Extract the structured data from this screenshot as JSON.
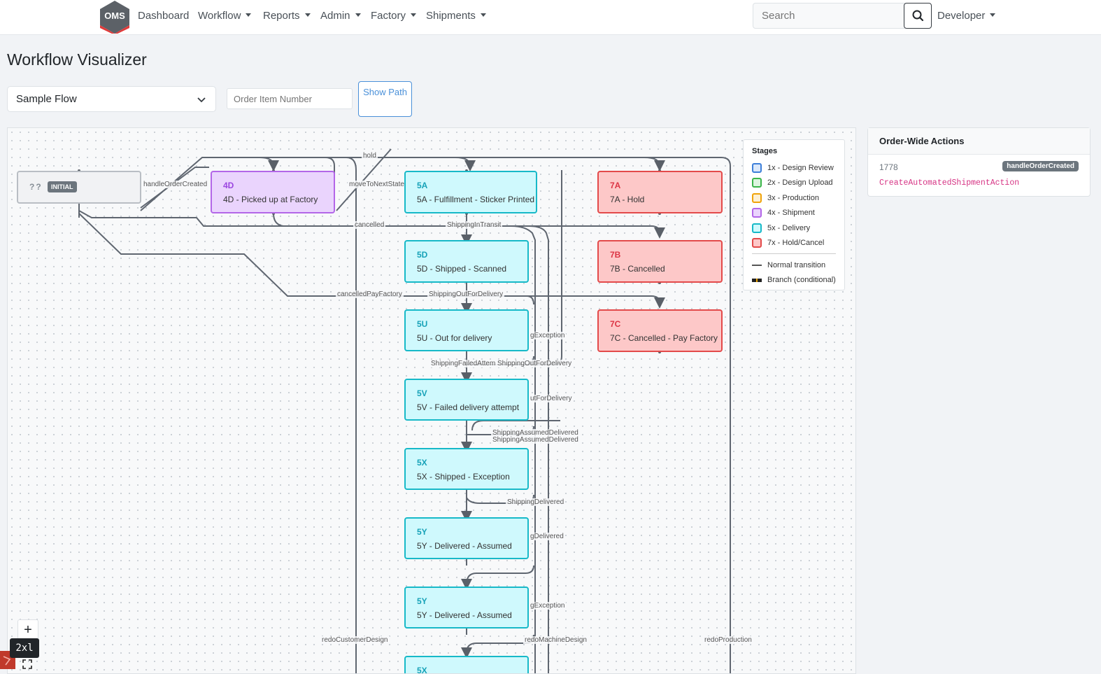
{
  "navbar": {
    "logo_text": "OMS",
    "items": [
      {
        "label": "Dashboard",
        "dropdown": false
      },
      {
        "label": "Workflow",
        "dropdown": true
      },
      {
        "label": "Reports",
        "dropdown": true
      },
      {
        "label": "Admin",
        "dropdown": true
      },
      {
        "label": "Factory",
        "dropdown": true
      },
      {
        "label": "Shipments",
        "dropdown": true
      }
    ],
    "search_placeholder": "Search",
    "search_icon": "search-icon",
    "user_menu": "Developer"
  },
  "page": {
    "title": "Workflow Visualizer",
    "flow_select_value": "Sample Flow",
    "order_input_placeholder": "Order Item Number",
    "show_path_label": "Show Path"
  },
  "diagram": {
    "nodes": [
      {
        "id": "initial",
        "code": "??",
        "badge": "INITIAL",
        "label": ""
      },
      {
        "id": "4D",
        "code": "4D",
        "label": "4D - Picked up at Factory"
      },
      {
        "id": "5A",
        "code": "5A",
        "label": "5A - Fulfillment - Sticker Printed"
      },
      {
        "id": "7A",
        "code": "7A",
        "label": "7A - Hold"
      },
      {
        "id": "5D",
        "code": "5D",
        "label": "5D - Shipped - Scanned"
      },
      {
        "id": "7B",
        "code": "7B",
        "label": "7B - Cancelled"
      },
      {
        "id": "5U",
        "code": "5U",
        "label": "5U - Out for delivery"
      },
      {
        "id": "7C",
        "code": "7C",
        "label": "7C - Cancelled - Pay Factory"
      },
      {
        "id": "5V",
        "code": "5V",
        "label": "5V - Failed delivery attempt"
      },
      {
        "id": "5X",
        "code": "5X",
        "label": "5X - Shipped - Exception"
      },
      {
        "id": "5Y1",
        "code": "5Y",
        "label": "5Y - Delivered - Assumed"
      },
      {
        "id": "5Y2",
        "code": "5Y",
        "label": "5Y - Delivered - Assumed"
      },
      {
        "id": "5Xb",
        "code": "5X",
        "label": ""
      }
    ],
    "edge_labels": [
      "hold",
      "handleOrderCreated",
      "moveToNextState",
      "cancelled",
      "ShippingInTransit",
      "cancelledPayFactory",
      "ShippingOutForDelivery",
      "gException",
      "ShippingFailedAttem",
      "ShippingOutForDelivery",
      "utForDelivery",
      "ShippingAssumedDelivered",
      "ShippingAssumedDelivered",
      "ShippingDelivered",
      "gDelivered",
      "gException",
      "redoCustomerDesign",
      "redoMachineDesign",
      "redoProduction"
    ]
  },
  "legend": {
    "title": "Stages",
    "stages": [
      {
        "label": "1x - Design Review",
        "color": "#3d7fd9"
      },
      {
        "label": "2x - Design Upload",
        "color": "#3bb54a"
      },
      {
        "label": "3x - Production",
        "color": "#f0a30a"
      },
      {
        "label": "4x - Shipment",
        "color": "#b366e8"
      },
      {
        "label": "5x - Delivery",
        "color": "#17b9c8"
      },
      {
        "label": "7x - Hold/Cancel",
        "color": "#e34a4a"
      }
    ],
    "normal_label": "Normal transition",
    "branch_label": "Branch (conditional)"
  },
  "controls": {
    "zoom_in": "+",
    "breakpoint": "2xl"
  },
  "actions": {
    "title": "Order-Wide Actions",
    "number": "1778",
    "badge": "handleOrderCreated",
    "class_name": "CreateAutomatedShipmentAction"
  }
}
